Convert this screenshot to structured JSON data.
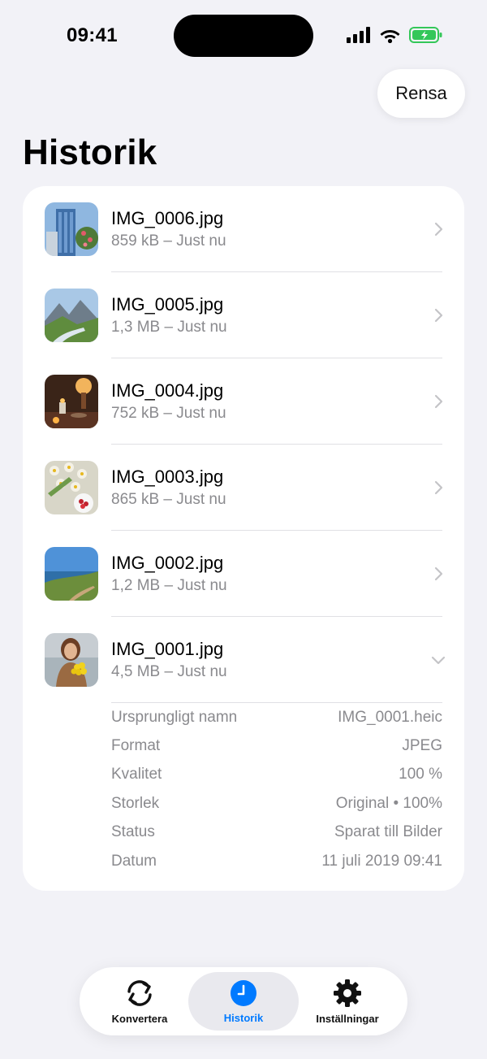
{
  "status_bar": {
    "time": "09:41"
  },
  "header": {
    "clear_label": "Rensa",
    "title": "Historik"
  },
  "history": [
    {
      "name": "IMG_0006.jpg",
      "meta": "859 kB – Just nu",
      "thumb": "building-icon",
      "expanded": false
    },
    {
      "name": "IMG_0005.jpg",
      "meta": "1,3 MB – Just nu",
      "thumb": "mountain-icon",
      "expanded": false
    },
    {
      "name": "IMG_0004.jpg",
      "meta": "752 kB – Just nu",
      "thumb": "candle-icon",
      "expanded": false
    },
    {
      "name": "IMG_0003.jpg",
      "meta": "865 kB – Just nu",
      "thumb": "flowers-icon",
      "expanded": false
    },
    {
      "name": "IMG_0002.jpg",
      "meta": "1,2 MB – Just nu",
      "thumb": "coast-icon",
      "expanded": false
    },
    {
      "name": "IMG_0001.jpg",
      "meta": "4,5 MB – Just nu",
      "thumb": "portrait-icon",
      "expanded": true
    }
  ],
  "details": [
    {
      "label": "Ursprungligt namn",
      "value": "IMG_0001.heic"
    },
    {
      "label": "Format",
      "value": "JPEG"
    },
    {
      "label": "Kvalitet",
      "value": "100 %"
    },
    {
      "label": "Storlek",
      "value": "Original • 100%"
    },
    {
      "label": "Status",
      "value": "Sparat till Bilder"
    },
    {
      "label": "Datum",
      "value": "11 juli 2019 09:41"
    }
  ],
  "tabs": [
    {
      "label": "Konvertera",
      "icon": "convert-icon",
      "active": false
    },
    {
      "label": "Historik",
      "icon": "clock-icon",
      "active": true
    },
    {
      "label": "Inställningar",
      "icon": "gear-icon",
      "active": false
    }
  ],
  "colors": {
    "accent": "#007AFF",
    "background": "#F2F2F7",
    "secondary_text": "#8A8A8E",
    "battery": "#34C759"
  }
}
